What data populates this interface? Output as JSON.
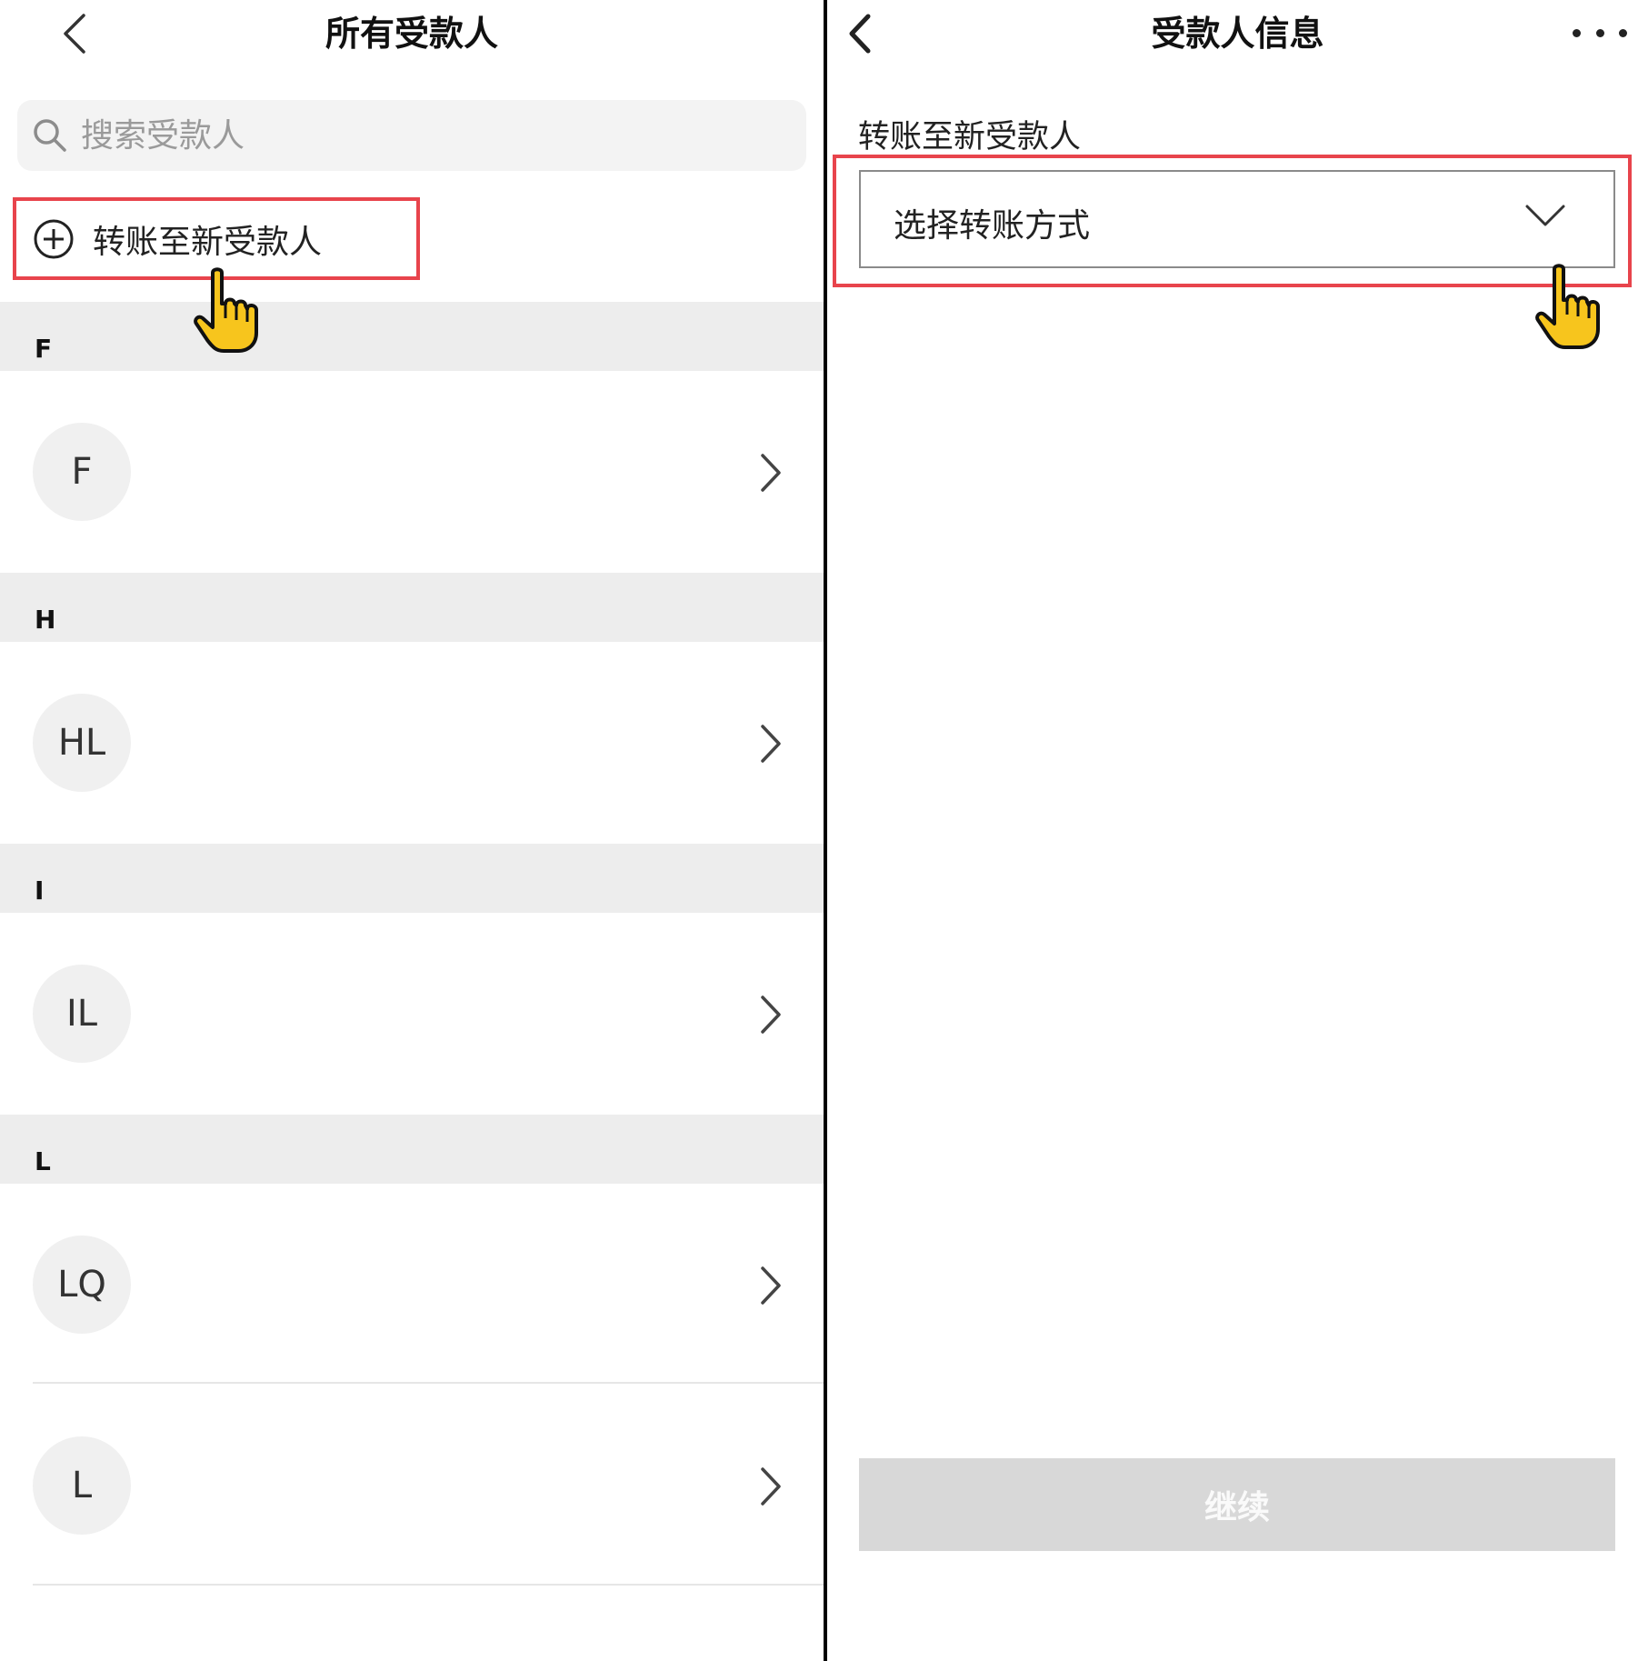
{
  "left": {
    "title": "所有受款人",
    "search_placeholder": "搜索受款人",
    "add_new_label": "转账至新受款人",
    "sections": [
      {
        "letter": "F",
        "contacts": [
          "F"
        ]
      },
      {
        "letter": "H",
        "contacts": [
          "HL"
        ]
      },
      {
        "letter": "I",
        "contacts": [
          "IL"
        ]
      },
      {
        "letter": "L",
        "contacts": [
          "LQ",
          "L"
        ]
      }
    ]
  },
  "right": {
    "title": "受款人信息",
    "field_label": "转账至新受款人",
    "select_placeholder": "选择转账方式",
    "continue_label": "继续"
  },
  "colors": {
    "highlight": "#e8444c",
    "section_bg": "#ededed",
    "avatar_bg": "#f0f0f0",
    "disabled_button": "#d8d8d8",
    "pointer_hand": "#f7c51d"
  },
  "icons": [
    "back-icon",
    "search-icon",
    "add-circle-icon",
    "chevron-right-icon",
    "chevron-down-icon",
    "more-icon",
    "pointing-hand-icon"
  ]
}
